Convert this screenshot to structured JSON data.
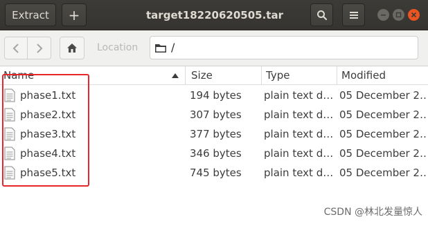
{
  "headerbar": {
    "extract_label": "Extract",
    "add_label": "+",
    "title": "target18220620505.tar"
  },
  "locbar": {
    "location_label": "Location",
    "path": "/"
  },
  "columns": {
    "name": "Name",
    "size": "Size",
    "type": "Type",
    "modified": "Modified"
  },
  "files": [
    {
      "name": "phase1.txt",
      "size": "194 bytes",
      "type": "plain text d…",
      "modified": "05 December 2…"
    },
    {
      "name": "phase2.txt",
      "size": "307 bytes",
      "type": "plain text d…",
      "modified": "05 December 2…"
    },
    {
      "name": "phase3.txt",
      "size": "377 bytes",
      "type": "plain text d…",
      "modified": "05 December 2…"
    },
    {
      "name": "phase4.txt",
      "size": "346 bytes",
      "type": "plain text d…",
      "modified": "05 December 2…"
    },
    {
      "name": "phase5.txt",
      "size": "745 bytes",
      "type": "plain text d…",
      "modified": "05 December 2…"
    }
  ],
  "watermark": "CSDN @林北发量惊人",
  "colors": {
    "headerbar": "#3c3b37",
    "close": "#e95420",
    "annotation": "#e8262a"
  },
  "icons": [
    "search-icon",
    "menu-icon",
    "back-icon",
    "forward-icon",
    "home-icon",
    "folder-icon",
    "file-text-icon",
    "sort-up-icon"
  ]
}
